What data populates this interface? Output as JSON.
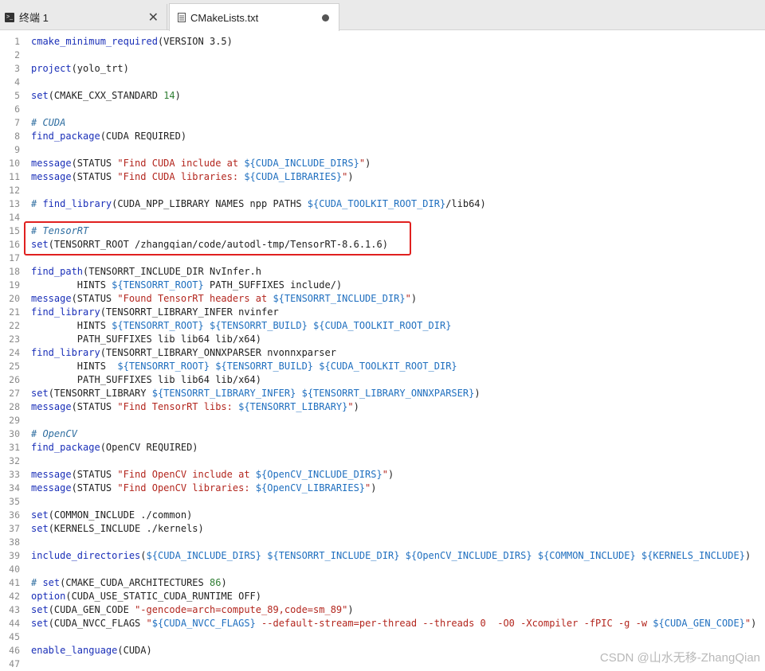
{
  "tabs": [
    {
      "label": "终端 1",
      "icon": "terminal-icon",
      "close": "✕"
    },
    {
      "label": "CMakeLists.txt",
      "icon": "file-icon",
      "modified": true
    }
  ],
  "line_numbers": [
    "1",
    "2",
    "3",
    "4",
    "5",
    "6",
    "7",
    "8",
    "9",
    "10",
    "11",
    "12",
    "13",
    "14",
    "15",
    "16",
    "17",
    "18",
    "19",
    "20",
    "21",
    "22",
    "23",
    "24",
    "25",
    "26",
    "27",
    "28",
    "29",
    "30",
    "31",
    "32",
    "33",
    "34",
    "35",
    "36",
    "37",
    "38",
    "39",
    "40",
    "41",
    "42",
    "43",
    "44",
    "45",
    "46",
    "47"
  ],
  "code": {
    "l1": {
      "a": "cmake_minimum_required",
      "b": "(VERSION 3.5)"
    },
    "l3": {
      "a": "project",
      "b": "(yolo_trt)"
    },
    "l5": {
      "a": "set",
      "b": "(CMAKE_CXX_STANDARD ",
      "c": "14",
      "d": ")"
    },
    "l7": {
      "a": "# CUDA"
    },
    "l8": {
      "a": "find_package",
      "b": "(CUDA REQUIRED)"
    },
    "l10": {
      "a": "message",
      "b": "(STATUS ",
      "c": "\"Find CUDA include at ",
      "d": "${CUDA_INCLUDE_DIRS}",
      "e": "\"",
      "f": ")"
    },
    "l11": {
      "a": "message",
      "b": "(STATUS ",
      "c": "\"Find CUDA libraries: ",
      "d": "${CUDA_LIBRARIES}",
      "e": "\"",
      "f": ")"
    },
    "l13": {
      "a": "# ",
      "b": "find_library",
      "c": "(CUDA_NPP_LIBRARY NAMES npp PATHS ",
      "d": "${CUDA_TOOLKIT_ROOT_DIR}",
      "e": "/lib64)"
    },
    "l15": {
      "a": "# TensorRT"
    },
    "l16": {
      "a": "set",
      "b": "(TENSORRT_ROOT /zhangqian/code/autodl-tmp/TensorRT-8.6.1.6)"
    },
    "l18": {
      "a": "find_path",
      "b": "(TENSORRT_INCLUDE_DIR NvInfer.h"
    },
    "l19": {
      "a": "        HINTS ",
      "b": "${TENSORRT_ROOT}",
      "c": " PATH_SUFFIXES include/)"
    },
    "l20": {
      "a": "message",
      "b": "(STATUS ",
      "c": "\"Found TensorRT headers at ",
      "d": "${TENSORRT_INCLUDE_DIR}",
      "e": "\"",
      "f": ")"
    },
    "l21": {
      "a": "find_library",
      "b": "(TENSORRT_LIBRARY_INFER nvinfer"
    },
    "l22": {
      "a": "        HINTS ",
      "b": "${TENSORRT_ROOT}",
      "c": " ",
      "d": "${TENSORRT_BUILD}",
      "e": " ",
      "f": "${CUDA_TOOLKIT_ROOT_DIR}"
    },
    "l23": {
      "a": "        PATH_SUFFIXES lib lib64 lib/x64)"
    },
    "l24": {
      "a": "find_library",
      "b": "(TENSORRT_LIBRARY_ONNXPARSER nvonnxparser"
    },
    "l25": {
      "a": "        HINTS  ",
      "b": "${TENSORRT_ROOT}",
      "c": " ",
      "d": "${TENSORRT_BUILD}",
      "e": " ",
      "f": "${CUDA_TOOLKIT_ROOT_DIR}"
    },
    "l26": {
      "a": "        PATH_SUFFIXES lib lib64 lib/x64)"
    },
    "l27": {
      "a": "set",
      "b": "(TENSORRT_LIBRARY ",
      "c": "${TENSORRT_LIBRARY_INFER}",
      "d": " ",
      "e": "${TENSORRT_LIBRARY_ONNXPARSER}",
      "f": ")"
    },
    "l28": {
      "a": "message",
      "b": "(STATUS ",
      "c": "\"Find TensorRT libs: ",
      "d": "${TENSORRT_LIBRARY}",
      "e": "\"",
      "f": ")"
    },
    "l30": {
      "a": "# OpenCV"
    },
    "l31": {
      "a": "find_package",
      "b": "(OpenCV REQUIRED)"
    },
    "l33": {
      "a": "message",
      "b": "(STATUS ",
      "c": "\"Find OpenCV include at ",
      "d": "${OpenCV_INCLUDE_DIRS}",
      "e": "\"",
      "f": ")"
    },
    "l34": {
      "a": "message",
      "b": "(STATUS ",
      "c": "\"Find OpenCV libraries: ",
      "d": "${OpenCV_LIBRARIES}",
      "e": "\"",
      "f": ")"
    },
    "l36": {
      "a": "set",
      "b": "(COMMON_INCLUDE ./common)"
    },
    "l37": {
      "a": "set",
      "b": "(KERNELS_INCLUDE ./kernels)"
    },
    "l39": {
      "a": "include_directories",
      "b": "(",
      "c": "${CUDA_INCLUDE_DIRS}",
      "d": " ",
      "e": "${TENSORRT_INCLUDE_DIR}",
      "f": " ",
      "g": "${OpenCV_INCLUDE_DIRS}",
      "h": " ",
      "i": "${COMMON_INCLUDE}",
      "j": " ",
      "k": "${KERNELS_INCLUDE}",
      "l": ")"
    },
    "l41": {
      "a": "# ",
      "b": "set",
      "c": "(CMAKE_CUDA_ARCHITECTURES ",
      "d": "86",
      "e": ")"
    },
    "l42": {
      "a": "option",
      "b": "(CUDA_USE_STATIC_CUDA_RUNTIME OFF)"
    },
    "l43": {
      "a": "set",
      "b": "(CUDA_GEN_CODE ",
      "c": "\"-gencode=arch=compute_89,code=sm_89\"",
      "d": ")"
    },
    "l44": {
      "a": "set",
      "b": "(CUDA_NVCC_FLAGS ",
      "c": "\"",
      "d": "${CUDA_NVCC_FLAGS}",
      "e": " --default-stream=per-thread --threads 0  -O0 -Xcompiler -fPIC -g -w ",
      "f": "${CUDA_GEN_CODE}",
      "g": "\"",
      "h": ")"
    },
    "l46": {
      "a": "enable_language",
      "b": "(CUDA)"
    }
  },
  "watermark": "CSDN @山水无移-ZhangQian",
  "colors": {
    "keyword": "#1a2fb8",
    "comment": "#2f6ea0",
    "string": "#b3261e",
    "variable": "#1f6fbf",
    "number": "#2e7d32",
    "highlight": "#e0201f"
  }
}
